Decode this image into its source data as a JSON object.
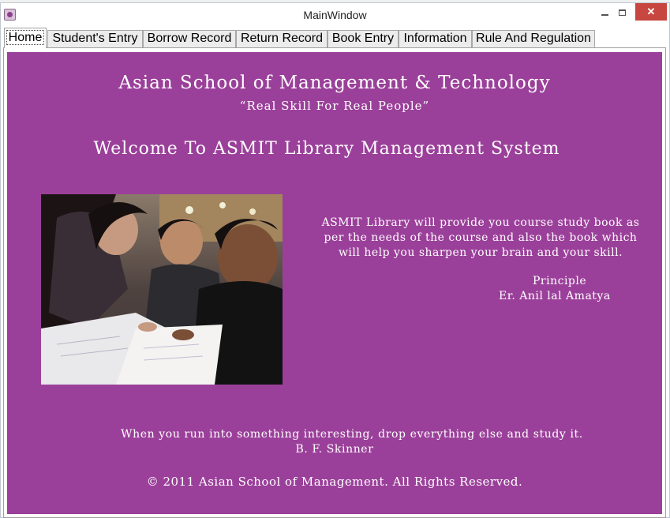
{
  "window": {
    "title": "MainWindow",
    "icon": "app-icon",
    "controls": {
      "minimize": "minimize-icon",
      "maximize": "maximize-icon",
      "close": "close-icon"
    }
  },
  "tabs": [
    {
      "label": "Home",
      "active": true
    },
    {
      "label": "Student's Entry",
      "active": false
    },
    {
      "label": "Borrow Record",
      "active": false
    },
    {
      "label": "Return Record",
      "active": false
    },
    {
      "label": "Book Entry",
      "active": false
    },
    {
      "label": "Information",
      "active": false
    },
    {
      "label": "Rule And Regulation",
      "active": false
    }
  ],
  "home": {
    "school_name": "Asian School of Management & Technology",
    "tagline": "“Real Skill For Real People”",
    "welcome": "Welcome To ASMIT Library Management System",
    "description": "ASMIT Library will provide you course study book as per the needs of the course and also the book which will help you sharpen your brain and your skill.",
    "principal_title": "Principle",
    "principal_name": "Er. Anil lal Amatya",
    "quote": "When you run into something interesting, drop everything else and study it.",
    "quote_author": "B. F. Skinner",
    "copyright": "© 2011 Asian School of Management. All Rights Reserved."
  },
  "colors": {
    "panel_background": "#9b409a",
    "text": "#ffffff",
    "close_button": "#c7463f"
  }
}
